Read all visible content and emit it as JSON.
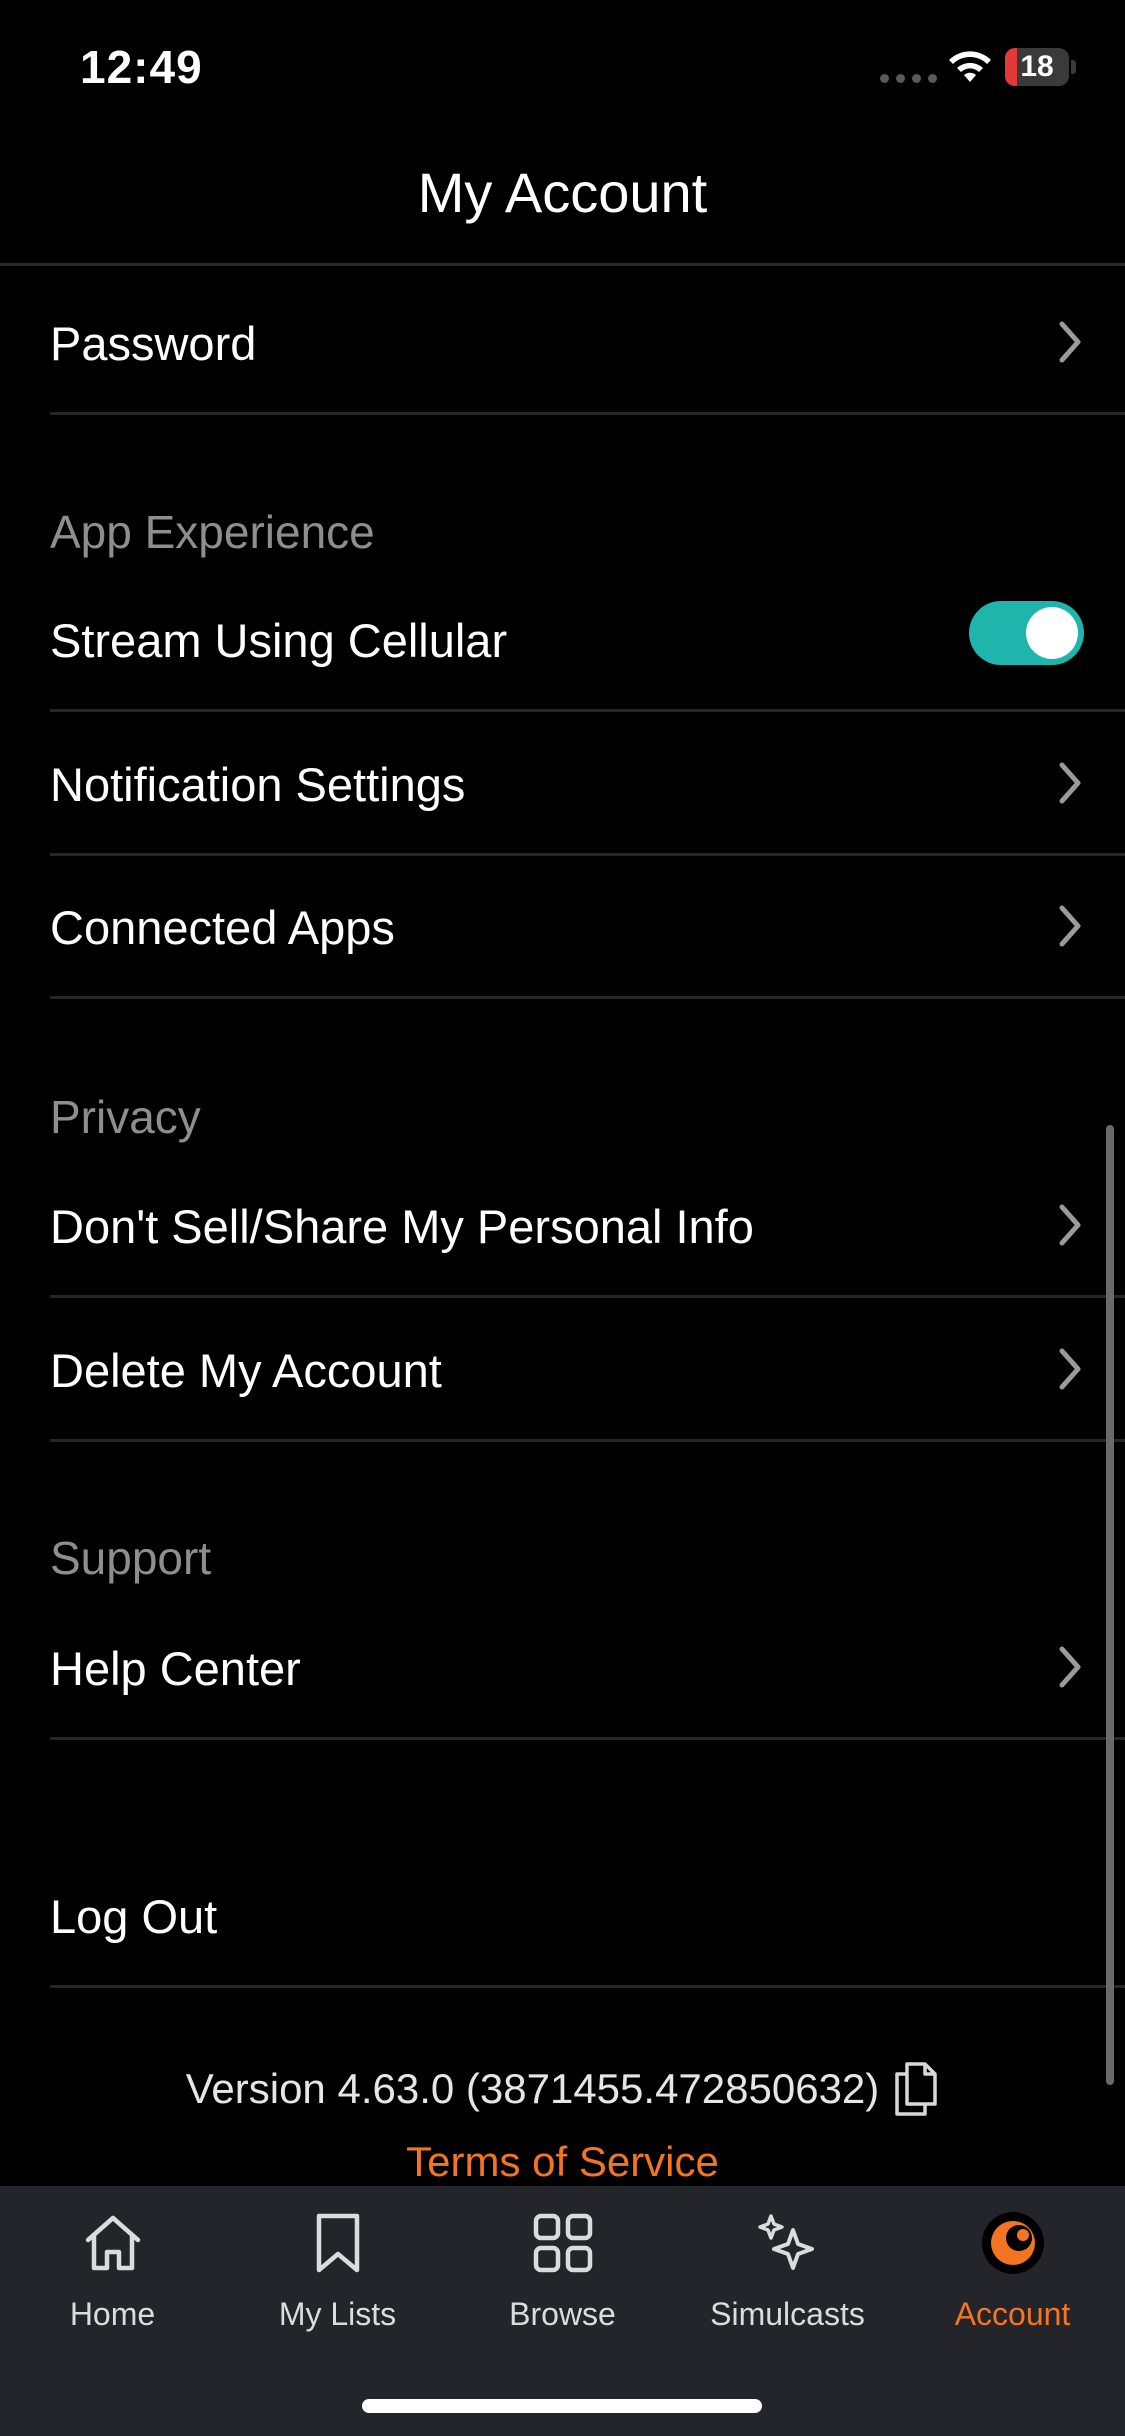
{
  "status_bar": {
    "time": "12:49",
    "battery": "18"
  },
  "header": {
    "title": "My Account"
  },
  "rows": {
    "password": "Password",
    "stream_cellular": "Stream Using Cellular",
    "notification_settings": "Notification Settings",
    "connected_apps": "Connected Apps",
    "dont_sell": "Don't Sell/Share My Personal Info",
    "delete_account": "Delete My Account",
    "help_center": "Help Center",
    "log_out": "Log Out"
  },
  "sections": {
    "app_experience": "App Experience",
    "privacy": "Privacy",
    "support": "Support"
  },
  "toggles": {
    "stream_cellular_on": true
  },
  "footer": {
    "version": "Version 4.63.0 (3871455.472850632)",
    "terms": "Terms of Service"
  },
  "tabbar": {
    "items": [
      {
        "label": "Home",
        "icon": "home-icon"
      },
      {
        "label": "My Lists",
        "icon": "bookmark-icon"
      },
      {
        "label": "Browse",
        "icon": "grid-icon"
      },
      {
        "label": "Simulcasts",
        "icon": "sparkle-icon"
      },
      {
        "label": "Account",
        "icon": "avatar-icon"
      }
    ],
    "active": "Account"
  },
  "colors": {
    "accent": "#f47521",
    "toggle_on": "#1fb5ac",
    "tabbar_bg": "#23252b"
  }
}
